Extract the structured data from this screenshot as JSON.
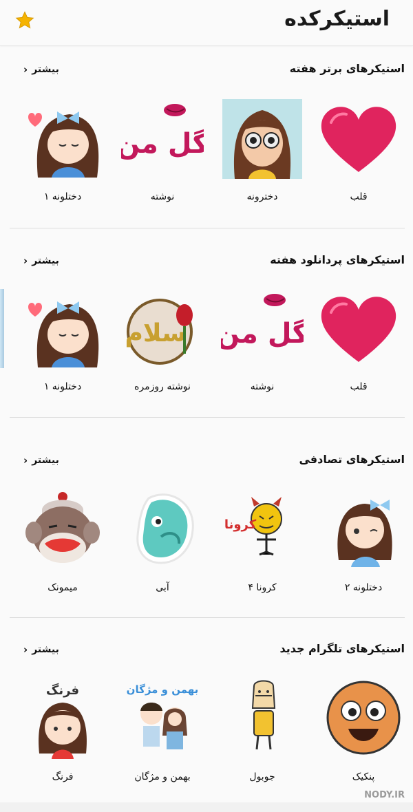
{
  "header": {
    "title": "استیکرکده",
    "favorite_icon": "star-icon",
    "star_color": "#f5b301"
  },
  "sections": [
    {
      "title": "استیکرهای برتر هفته",
      "more": "بیشتر",
      "items": [
        {
          "label": "قلب",
          "icon": "heart-sticker"
        },
        {
          "label": "دخترونه",
          "icon": "girl-glasses-sticker"
        },
        {
          "label": "نوشته",
          "icon": "calligraphy-sticker"
        },
        {
          "label": "دختلونه ۱",
          "icon": "cartoon-girl-sticker"
        }
      ]
    },
    {
      "title": "استیکرهای پردانلود هفته",
      "more": "بیشتر",
      "items": [
        {
          "label": "قلب",
          "icon": "heart-sticker"
        },
        {
          "label": "نوشته",
          "icon": "calligraphy-sticker"
        },
        {
          "label": "نوشته روزمره",
          "icon": "salam-tulip-sticker"
        },
        {
          "label": "دختلونه ۱",
          "icon": "cartoon-girl-sticker"
        }
      ]
    },
    {
      "title": "استیکرهای تصادفی",
      "more": "بیشتر",
      "items": [
        {
          "label": "دختلونه ۲",
          "icon": "cartoon-girl-2-sticker"
        },
        {
          "label": "کرونا ۴",
          "icon": "corona-devil-sticker"
        },
        {
          "label": "آبی",
          "icon": "blue-creature-sticker"
        },
        {
          "label": "میمونک",
          "icon": "sock-monkey-sticker"
        }
      ]
    },
    {
      "title": "استیکرهای تلگرام جدید",
      "more": "بیشتر",
      "items": [
        {
          "label": "پنکیک",
          "icon": "pancake-face-sticker"
        },
        {
          "label": "جوبول",
          "icon": "robot-sticker"
        },
        {
          "label": "بهمن و مژگان",
          "icon": "couple-sticker"
        },
        {
          "label": "فرنگ",
          "icon": "farang-girl-sticker"
        }
      ]
    }
  ],
  "sticker_text": {
    "gol_man": "گل من",
    "salam": "سلام",
    "corona": "کرونا",
    "bahman": "بهمن و مژگان",
    "farang": "فرنگ"
  },
  "watermark": "NODY.IR"
}
